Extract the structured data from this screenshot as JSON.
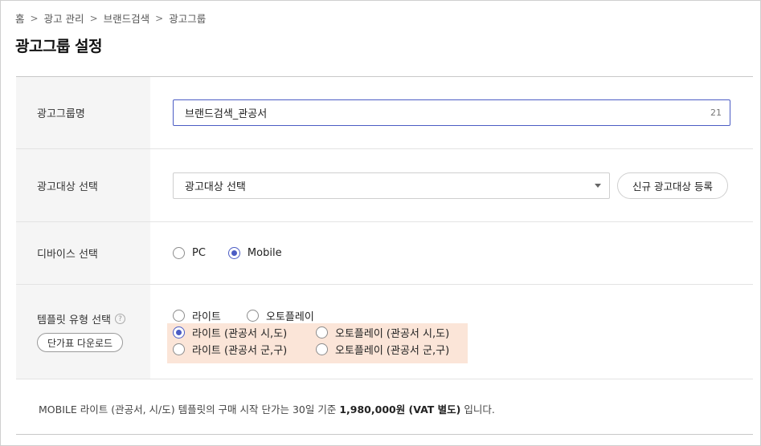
{
  "breadcrumb": [
    "홈",
    "광고 관리",
    "브랜드검색",
    "광고그룹"
  ],
  "page_title": "광고그룹 설정",
  "rows": {
    "name": {
      "label": "광고그룹명",
      "value": "브랜드검색_관공서",
      "count": "21"
    },
    "target": {
      "label": "광고대상 선택",
      "select_value": "광고대상 선택",
      "register_button": "신규 광고대상 등록"
    },
    "device": {
      "label": "디바이스 선택",
      "options": [
        {
          "label": "PC",
          "checked": false
        },
        {
          "label": "Mobile",
          "checked": true
        }
      ]
    },
    "template": {
      "label": "템플릿 유형 선택",
      "help_glyph": "?",
      "download_button": "단가표 다운로드",
      "options": {
        "lite": "라이트",
        "autoplay": "오토플레이",
        "lite_city": "라이트 (관공서 시,도)",
        "autoplay_city": "오토플레이 (관공서 시,도)",
        "lite_county": "라이트 (관공서 군,구)",
        "autoplay_county": "오토플레이 (관공서 군,구)"
      },
      "selected": "lite_city",
      "highlight_color": "#fbe5d8"
    }
  },
  "notice": {
    "prefix": "MOBILE 라이트 (관공서, 시/도) 템플릿의 구매 시작 단가는 30일 기준 ",
    "price": "1,980,000원 (VAT 별도)",
    "suffix": " 입니다."
  },
  "colors": {
    "accent": "#4b5cc4",
    "label_bg": "#f5f5f5"
  }
}
